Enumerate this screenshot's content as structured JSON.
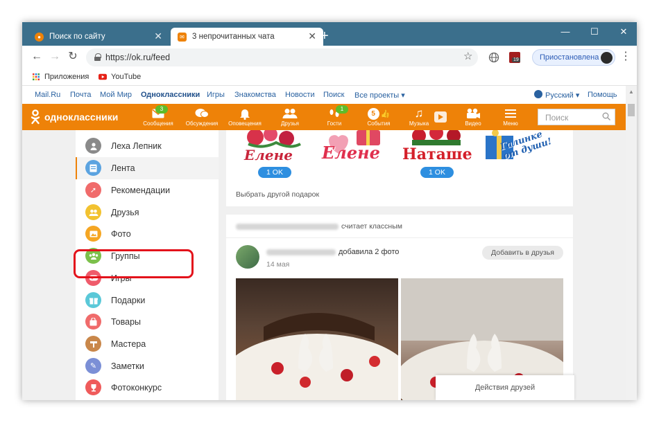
{
  "browser": {
    "tabs": [
      {
        "title": "Поиск по сайту",
        "active": false
      },
      {
        "title": "3 непрочитанных чата",
        "active": true
      }
    ],
    "url": "https://ok.ru/feed",
    "profile_status": "Приостановлена",
    "extension_badge": "19",
    "accent_color": "#3b6f8c"
  },
  "bookmarks": [
    {
      "label": "Приложения",
      "icon": "apps-grid-icon"
    },
    {
      "label": "YouTube",
      "icon": "youtube-icon"
    }
  ],
  "portal_bar": {
    "links": [
      "Mail.Ru",
      "Почта",
      "Мой Мир",
      "Одноклассники",
      "Игры",
      "Знакомства",
      "Новости",
      "Поиск",
      "Все проекты ▾"
    ],
    "language": "Русский ▾",
    "help": "Помощь"
  },
  "ok_header": {
    "logo_text": "одноклассники",
    "brand_color": "#ee8208",
    "nav": [
      {
        "label": "Сообщения",
        "badge": "3",
        "icon": "envelope-icon"
      },
      {
        "label": "Обсуждения",
        "badge": "",
        "icon": "chat-bubbles-icon"
      },
      {
        "label": "Оповещения",
        "badge": "",
        "icon": "bell-icon"
      },
      {
        "label": "Друзья",
        "badge": "",
        "icon": "friends-icon"
      },
      {
        "label": "Гости",
        "badge": "1",
        "icon": "footprints-icon"
      },
      {
        "label": "События",
        "badge": "5",
        "icon": "events-icon"
      },
      {
        "label": "Музыка",
        "badge": "",
        "icon": "music-note-icon"
      },
      {
        "label": "Видео",
        "badge": "",
        "icon": "video-camera-icon"
      },
      {
        "label": "Меню",
        "badge": "",
        "icon": "hamburger-menu-icon"
      }
    ],
    "search_placeholder": "Поиск"
  },
  "left_menu": {
    "items": [
      {
        "label": "Леха Лепник",
        "icon": "user-avatar-icon",
        "color": "#8a8a8a",
        "active": false
      },
      {
        "label": "Лента",
        "icon": "feed-icon",
        "color": "#5ba3e0",
        "active": true
      },
      {
        "label": "Рекомендации",
        "icon": "compass-icon",
        "color": "#f06b6b",
        "active": false
      },
      {
        "label": "Друзья",
        "icon": "friends-icon",
        "color": "#f2c230",
        "active": false
      },
      {
        "label": "Фото",
        "icon": "photo-icon",
        "color": "#f5a623",
        "active": false
      },
      {
        "label": "Группы",
        "icon": "groups-icon",
        "color": "#7cc04b",
        "active": false
      },
      {
        "label": "Игры",
        "icon": "gamepad-icon",
        "color": "#ef5b6b",
        "active": false
      },
      {
        "label": "Подарки",
        "icon": "gift-icon",
        "color": "#5ac8d8",
        "active": false
      },
      {
        "label": "Товары",
        "icon": "shopping-bag-icon",
        "color": "#f06b6b",
        "active": false
      },
      {
        "label": "Мастера",
        "icon": "master-icon",
        "color": "#c9874a",
        "active": false
      },
      {
        "label": "Заметки",
        "icon": "pencil-icon",
        "color": "#7b8fd6",
        "active": false
      },
      {
        "label": "Фотоконкурс",
        "icon": "trophy-icon",
        "color": "#ef5b5b",
        "active": false
      }
    ],
    "highlight_color": "#e3121b"
  },
  "feed": {
    "gift_card": {
      "gifts": [
        {
          "caption": "Елене",
          "button": "1 OK"
        },
        {
          "caption": "Елене",
          "button": ""
        },
        {
          "caption": "Наташе",
          "button": "1 OK"
        },
        {
          "caption": "Галинке от души!",
          "button": ""
        }
      ],
      "other_gift_link": "Выбрать другой подарок"
    },
    "post": {
      "liked_text": "считает классным",
      "author_action": "добавила 2 фото",
      "date": "14 мая",
      "add_friend_label": "Добавить в друзья"
    },
    "friends_actions_label": "Действия друзей"
  }
}
